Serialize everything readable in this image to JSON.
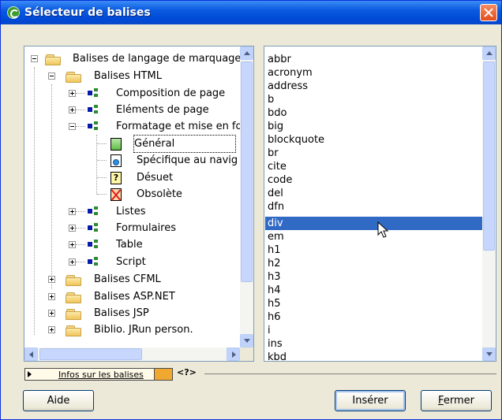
{
  "window": {
    "title": "Sélecteur de balises"
  },
  "tree": {
    "items": [
      {
        "label": "Balises de langage de marquage"
      },
      {
        "label": "Balises HTML"
      },
      {
        "label": "Composition de page"
      },
      {
        "label": "Eléments de page"
      },
      {
        "label": "Formatage et mise en fo"
      },
      {
        "label": "Général"
      },
      {
        "label": "Spécifique au navig"
      },
      {
        "label": "Désuet"
      },
      {
        "label": "Obsolète"
      },
      {
        "label": "Listes"
      },
      {
        "label": "Formulaires"
      },
      {
        "label": "Table"
      },
      {
        "label": "Script"
      },
      {
        "label": "Balises CFML"
      },
      {
        "label": "Balises ASP.NET"
      },
      {
        "label": "Balises JSP"
      },
      {
        "label": "Biblio. JRun person."
      }
    ]
  },
  "tags": {
    "items": [
      "abbr",
      "acronym",
      "address",
      "b",
      "bdo",
      "big",
      "blockquote",
      "br",
      "cite",
      "code",
      "del",
      "dfn",
      "div",
      "em",
      "h1",
      "h2",
      "h3",
      "h4",
      "h5",
      "h6",
      "i",
      "ins",
      "kbd"
    ],
    "selected": "div"
  },
  "infos": {
    "label": "Infos sur les balises",
    "help_glyph": "<?>"
  },
  "buttons": {
    "help": "Aide",
    "insert": "Insérer",
    "close_first": "F",
    "close_rest": "ermer"
  },
  "colors": {
    "selection": "#316ac5",
    "titlebar": "#0a5ae0",
    "dialog_bg": "#ece9d8"
  }
}
